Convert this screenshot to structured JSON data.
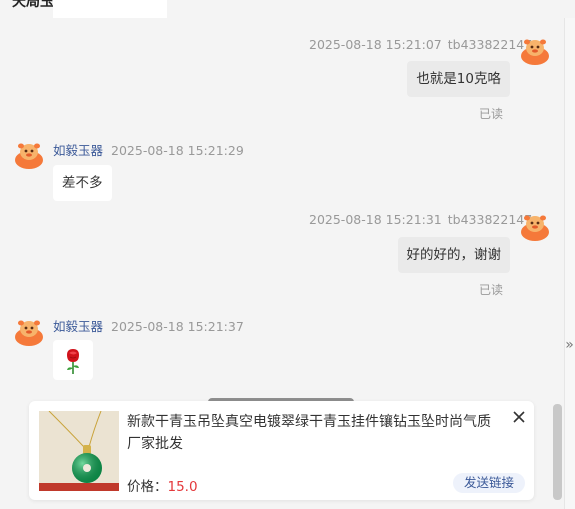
{
  "header": {
    "title": "天局玉器"
  },
  "messages": [
    {
      "direction": "out",
      "time": "2025-08-18 15:21:07",
      "sender": "tb433822147",
      "text": "也就是10克咯",
      "status": "已读"
    },
    {
      "direction": "in",
      "sender": "如毅玉器",
      "time": "2025-08-18 15:21:29",
      "text": "差不多"
    },
    {
      "direction": "out",
      "time": "2025-08-18 15:21:31",
      "sender": "tb433822147",
      "text": "好的好的，谢谢",
      "status": "已读"
    },
    {
      "direction": "in",
      "sender": "如毅玉器",
      "time": "2025-08-18 15:21:37",
      "text": "",
      "icon": "rose-icon"
    }
  ],
  "product_card": {
    "title": "新款干青玉吊坠真空电镀翠绿干青玉挂件镶钻玉坠时尚气质厂家批发",
    "price_label": "价格：",
    "price": "15.0",
    "send_label": "发送链接",
    "close_icon": "close-icon",
    "image_icon": "jade-pendant-thumbnail"
  },
  "side": {
    "collapse_icon": "double-chevron-right-icon"
  },
  "colors": {
    "background": "#f4f4f4",
    "bubble_in": "#ffffff",
    "bubble_out": "#eaeaea",
    "name": "#3b5998",
    "price": "#e4393c",
    "avatar": "#f5793a"
  }
}
